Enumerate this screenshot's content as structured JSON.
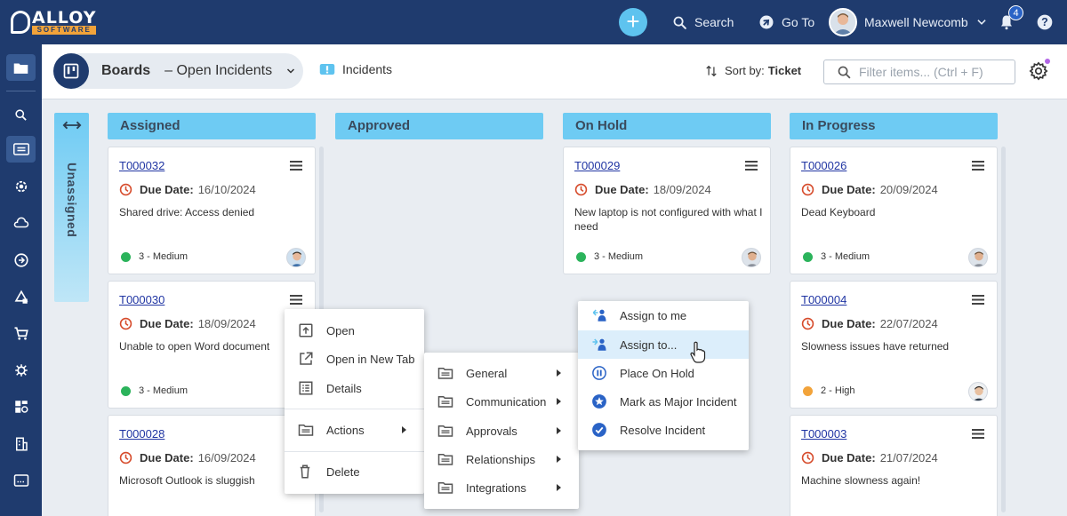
{
  "app": {
    "logo_text": "ALLOY",
    "logo_sub": "SOFTWARE"
  },
  "topbar": {
    "search_label": "Search",
    "goto_label": "Go To",
    "user_name": "Maxwell Newcomb",
    "notification_count": "4"
  },
  "header": {
    "boards_title": "Boards",
    "boards_view": "–  Open Incidents",
    "object_type": "Incidents",
    "sort_prefix": "Sort by:",
    "sort_value": "Ticket",
    "filter_placeholder": "Filter items... (Ctrl + F)"
  },
  "unassigned_label": "Unassigned",
  "columns": [
    {
      "title": "Assigned"
    },
    {
      "title": "Approved"
    },
    {
      "title": "On Hold"
    },
    {
      "title": "In Progress"
    }
  ],
  "due_label": "Due Date:",
  "cards": {
    "assigned": [
      {
        "ticket": "T000032",
        "due": "16/10/2024",
        "desc": "Shared drive: Access denied",
        "priority": "3 - Medium",
        "priority_color": "#2bb35b"
      },
      {
        "ticket": "T000030",
        "due": "18/09/2024",
        "desc": "Unable to open Word document",
        "priority": "3 - Medium",
        "priority_color": "#2bb35b"
      },
      {
        "ticket": "T000028",
        "due": "16/09/2024",
        "desc": "Microsoft Outlook is sluggish"
      }
    ],
    "on_hold": [
      {
        "ticket": "T000029",
        "due": "18/09/2024",
        "desc": "New laptop is not configured with what I need",
        "priority": "3 - Medium",
        "priority_color": "#2bb35b"
      }
    ],
    "in_progress": [
      {
        "ticket": "T000026",
        "due": "20/09/2024",
        "desc": "Dead Keyboard",
        "priority": "3 - Medium",
        "priority_color": "#2bb35b"
      },
      {
        "ticket": "T000004",
        "due": "22/07/2024",
        "desc": "Slowness issues have returned",
        "priority": "2 - High",
        "priority_color": "#f2a33a"
      },
      {
        "ticket": "T000003",
        "due": "21/07/2024",
        "desc": "Machine slowness again!"
      }
    ]
  },
  "context_menu": {
    "open": "Open",
    "open_new_tab": "Open in New Tab",
    "details": "Details",
    "actions": "Actions",
    "delete": "Delete"
  },
  "actions_menu": [
    "General",
    "Communication",
    "Approvals",
    "Relationships",
    "Integrations"
  ],
  "general_menu": {
    "assign_to_me": "Assign to me",
    "assign_to": "Assign to...",
    "place_on_hold": "Place On Hold",
    "mark_major": "Mark as Major Incident",
    "resolve": "Resolve Incident"
  },
  "colors": {
    "topbar": "#1f3b6e",
    "column_header": "#6ecbf3",
    "accent": "#5ec3ef",
    "due_icon": "#d64b2b",
    "menu_highlight": "#dceefb"
  }
}
